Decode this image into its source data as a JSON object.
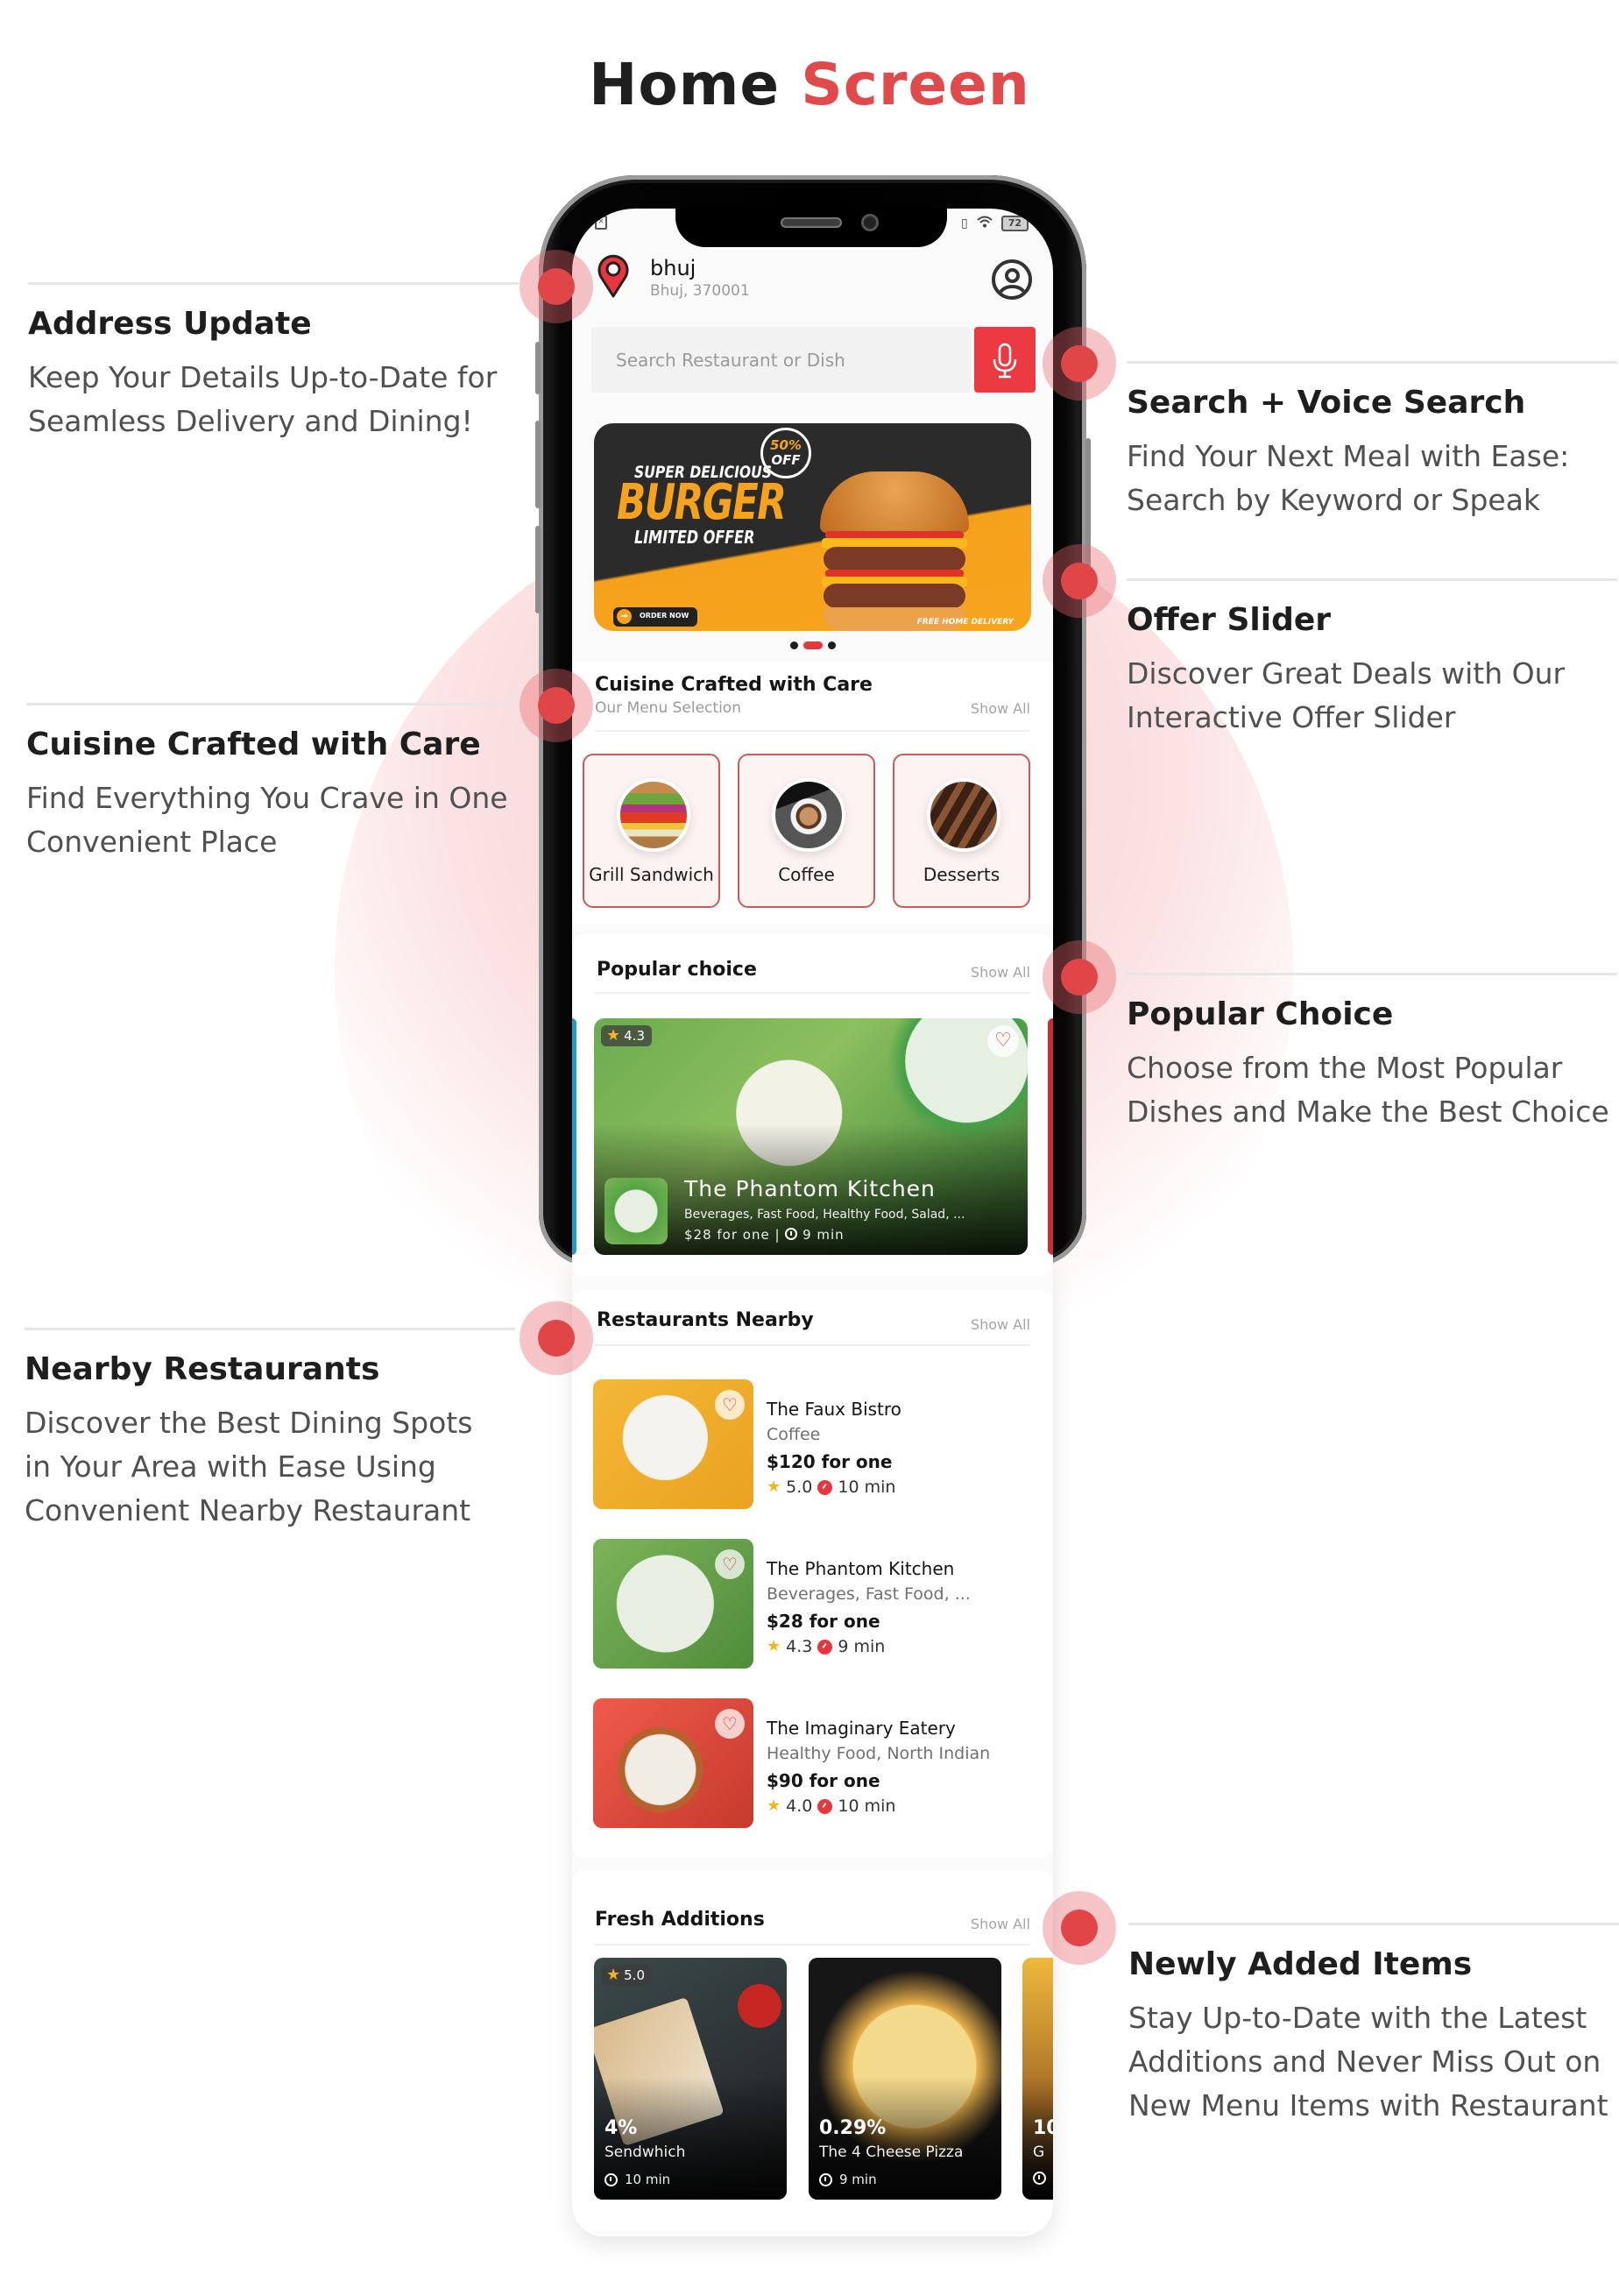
{
  "page": {
    "title_part1": "Home",
    "title_part2": "Screen",
    "accent_color": "#e04a4a"
  },
  "annotations": [
    {
      "id": "address",
      "title": "Address Update",
      "lines": [
        "Keep Your Details Up-to-Date for",
        "Seamless Delivery and Dining!"
      ]
    },
    {
      "id": "search",
      "title": "Search + Voice Search",
      "lines": [
        "Find Your Next Meal with Ease:",
        "Search by Keyword or Speak"
      ]
    },
    {
      "id": "offer",
      "title": "Offer Slider",
      "lines": [
        "Discover Great Deals with Our",
        "Interactive Offer Slider"
      ]
    },
    {
      "id": "cuisine",
      "title": "Cuisine Crafted with Care",
      "lines": [
        "Find Everything You Crave in One",
        "Convenient Place"
      ]
    },
    {
      "id": "popular",
      "title": "Popular Choice",
      "lines": [
        "Choose from the Most Popular",
        "Dishes and Make the Best Choice"
      ]
    },
    {
      "id": "nearby",
      "title": "Nearby Restaurants",
      "lines": [
        "Discover the Best Dining Spots",
        "in Your Area with Ease Using",
        "Convenient Nearby Restaurant"
      ]
    },
    {
      "id": "newly",
      "title": "Newly Added Items",
      "lines": [
        "Stay Up-to-Date with the Latest",
        "Additions and Never Miss Out on",
        "New Menu Items with Restaurant"
      ]
    }
  ],
  "status_bar": {
    "battery": "72",
    "icons": [
      "sim-error-icon",
      "vibrate-icon",
      "wifi-icon",
      "battery-icon"
    ]
  },
  "header": {
    "city": "bhuj",
    "address": "Bhuj, 370001",
    "icons": [
      "location-pin-icon",
      "profile-icon"
    ]
  },
  "search": {
    "placeholder": "Search Restaurant or Dish",
    "voice_icon": "microphone-icon"
  },
  "banner": {
    "line1": "SUPER DELICIOUS",
    "line2": "BURGER",
    "line3": "LIMITED OFFER",
    "discount_pct": "50%",
    "discount_off": "OFF",
    "cta": "ORDER NOW",
    "footer": "FREE HOME DELIVERY",
    "slides_total": 3,
    "active_slide": 2
  },
  "cuisine": {
    "title": "Cuisine Crafted with Care",
    "subtitle": "Our Menu Selection",
    "show_all": "Show All",
    "categories": [
      {
        "label": "Grill Sandwich"
      },
      {
        "label": "Coffee"
      },
      {
        "label": "Desserts"
      }
    ]
  },
  "popular": {
    "title": "Popular choice",
    "show_all": "Show All",
    "card": {
      "rating": "4.3",
      "name": "The Phantom Kitchen",
      "categories": "Beverages, Fast Food, Healthy Food, Salad, ...",
      "price": "$28 for one",
      "time": "9 min"
    }
  },
  "nearby": {
    "title": "Restaurants Nearby",
    "show_all": "Show All",
    "items": [
      {
        "name": "The Faux Bistro",
        "categories": "Coffee",
        "price": "$120 for one",
        "rating": "5.0",
        "time": "10 min"
      },
      {
        "name": "The Phantom Kitchen",
        "categories": "Beverages, Fast Food, ...",
        "price": "$28 for one",
        "rating": "4.3",
        "time": "9 min"
      },
      {
        "name": "The Imaginary Eatery",
        "categories": "Healthy Food, North Indian",
        "price": "$90 for one",
        "rating": "4.0",
        "time": "10 min"
      }
    ]
  },
  "fresh": {
    "title": "Fresh Additions",
    "show_all": "Show All",
    "items": [
      {
        "rating": "5.0",
        "discount": "4%",
        "name": "Sendwhich",
        "time": "10 min"
      },
      {
        "rating": "",
        "discount": "0.29%",
        "name": "The 4 Cheese Pizza",
        "time": "9 min"
      },
      {
        "rating": "",
        "discount": "10",
        "name": "G",
        "time": ""
      }
    ]
  }
}
